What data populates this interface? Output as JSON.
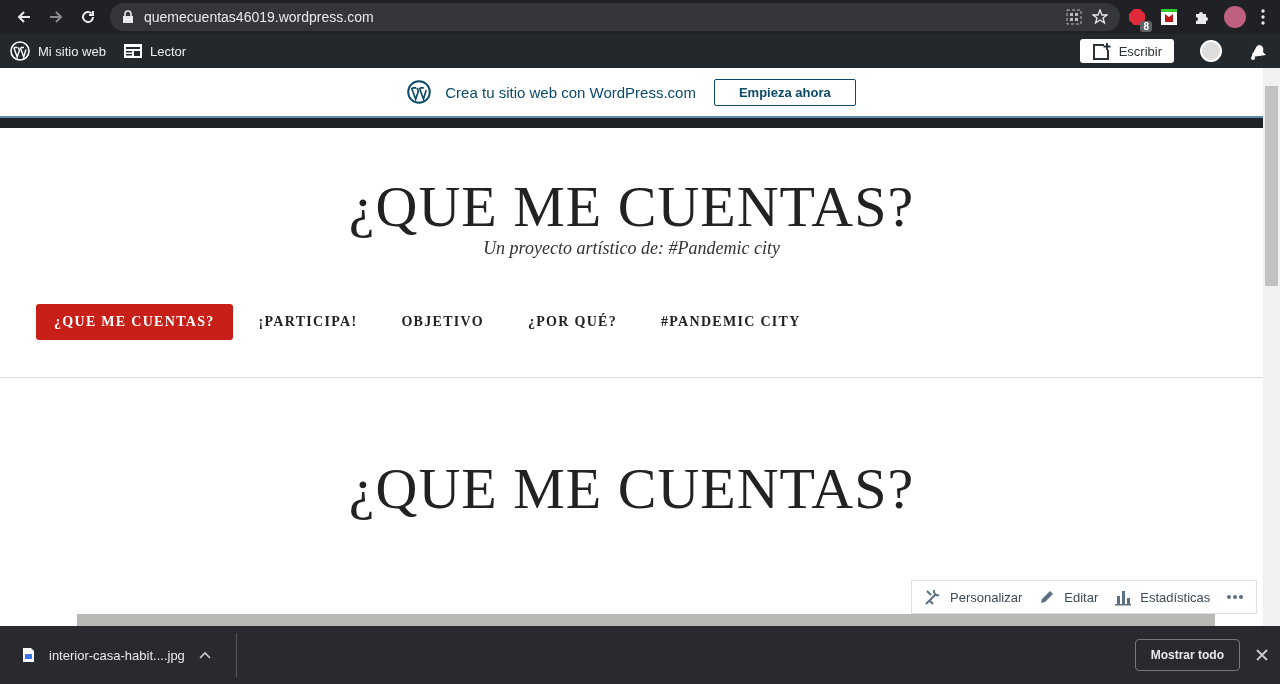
{
  "browser": {
    "url": "quemecuentas46019.wordpress.com",
    "extension_badge": "8"
  },
  "admin_bar": {
    "items": [
      {
        "kind": "wordpress",
        "label": "Mi sitio web"
      },
      {
        "kind": "reader",
        "label": "Lector"
      }
    ],
    "write_button": "Escribir"
  },
  "banner": {
    "text": "Crea tu sitio web con WordPress.com",
    "button": "Empieza ahora"
  },
  "site": {
    "title": "¿QUE ME CUENTAS?",
    "tagline": "Un proyecto artístico de: #Pandemic city"
  },
  "nav": [
    {
      "label": "¿QUE ME CUENTAS?",
      "selected": true
    },
    {
      "label": "¡PARTICIPA!",
      "selected": false
    },
    {
      "label": "OBJETIVO",
      "selected": false
    },
    {
      "label": "¿POR QUÉ?",
      "selected": false
    },
    {
      "label": "#PANDEMIC CITY",
      "selected": false
    }
  ],
  "page_title": "¿QUE ME CUENTAS?",
  "edit_toolbar": [
    {
      "kind": "customize",
      "label": "Personalizar"
    },
    {
      "kind": "edit",
      "label": "Editar"
    },
    {
      "kind": "stats",
      "label": "Estadísticas"
    }
  ],
  "download_bar": {
    "file": "interior-casa-habit....jpg",
    "show_all": "Mostrar todo"
  }
}
